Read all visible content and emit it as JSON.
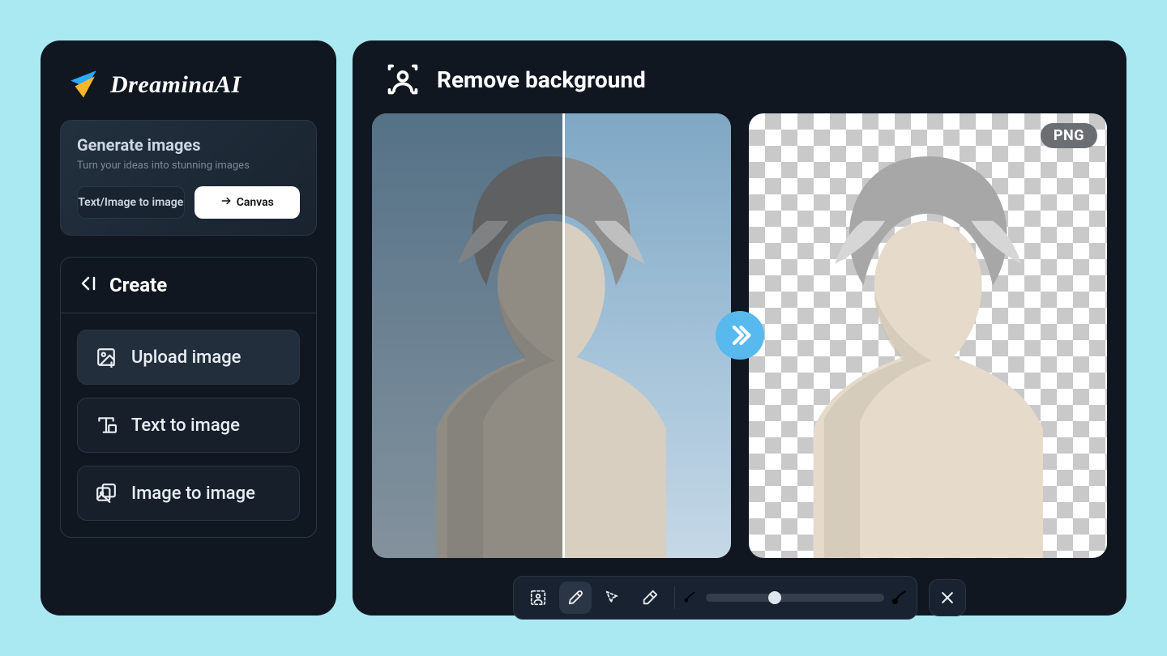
{
  "brand": {
    "name": "DreaminaAI"
  },
  "generate_card": {
    "title": "Generate images",
    "subtitle": "Turn your ideas into stunning images",
    "text_image_btn": "Text/Image to image",
    "canvas_btn": "Canvas"
  },
  "create": {
    "header": "Create",
    "items": [
      {
        "icon": "upload-icon",
        "label": "Upload image",
        "active": true
      },
      {
        "icon": "text-to-image-icon",
        "label": "Text to image",
        "active": false
      },
      {
        "icon": "image-to-image-icon",
        "label": "Image to image",
        "active": false
      }
    ]
  },
  "main": {
    "title": "Remove background",
    "png_badge": "PNG",
    "slider_value": 35
  },
  "toolbar": {
    "tools": [
      "auto-subject",
      "brush",
      "lasso",
      "eraser"
    ],
    "active_tool": "brush"
  }
}
